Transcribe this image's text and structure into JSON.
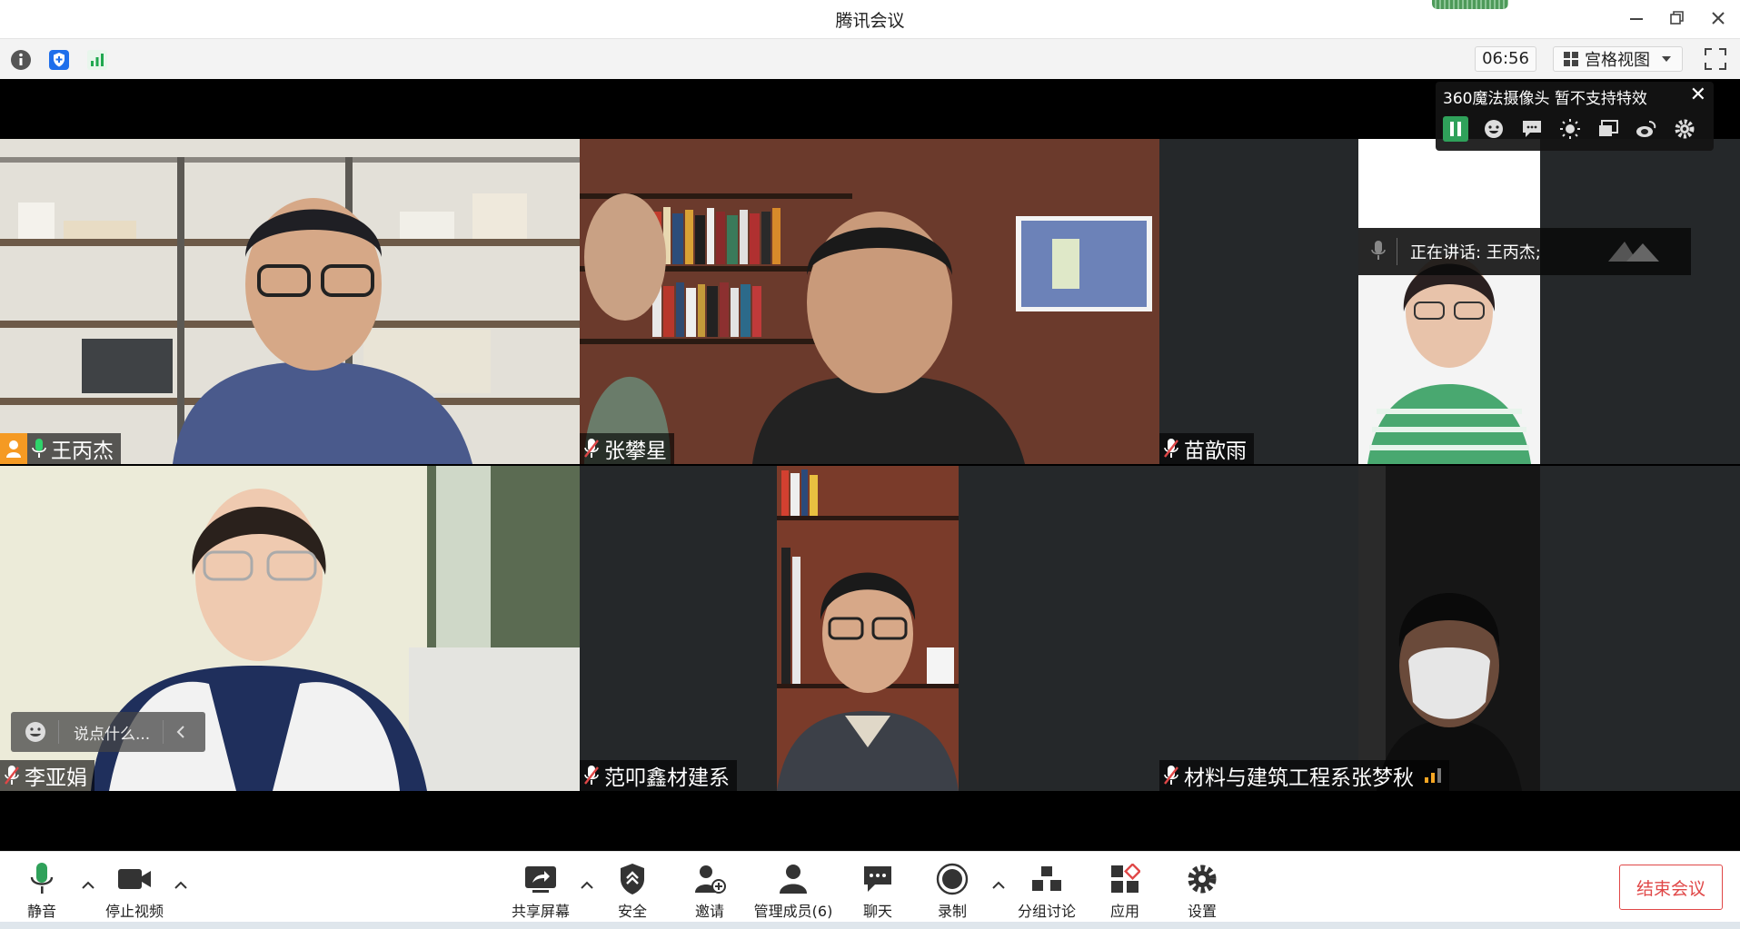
{
  "window": {
    "title": "腾讯会议"
  },
  "infobar": {
    "timer": "06:56",
    "view_label": "宫格视图"
  },
  "participants": [
    {
      "name": "王丙杰",
      "mic": "on"
    },
    {
      "name": "张攀星",
      "mic": "muted"
    },
    {
      "name": "苗歆雨",
      "mic": "muted"
    },
    {
      "name": "李亚娟",
      "mic": "muted"
    },
    {
      "name": "范叩鑫材建系",
      "mic": "muted"
    },
    {
      "name": "材料与建筑工程系张梦秋",
      "mic": "muted"
    }
  ],
  "speaking": {
    "text": "正在讲话: 王丙杰;"
  },
  "chat": {
    "placeholder": "说点什么..."
  },
  "camera_panel": {
    "title": "360魔法摄像头  暂不支持特效"
  },
  "toolbar": {
    "mute": "静音",
    "stop_video": "停止视频",
    "share_screen": "共享屏幕",
    "security": "安全",
    "invite": "邀请",
    "manage_members": "管理成员(6)",
    "chat": "聊天",
    "record": "录制",
    "breakout": "分组讨论",
    "apps": "应用",
    "settings": "设置",
    "end_meeting": "结束会议"
  },
  "colors": {
    "accent_green": "#2fa15a",
    "end_red": "#e04747",
    "badge_orange": "#f59a23"
  }
}
